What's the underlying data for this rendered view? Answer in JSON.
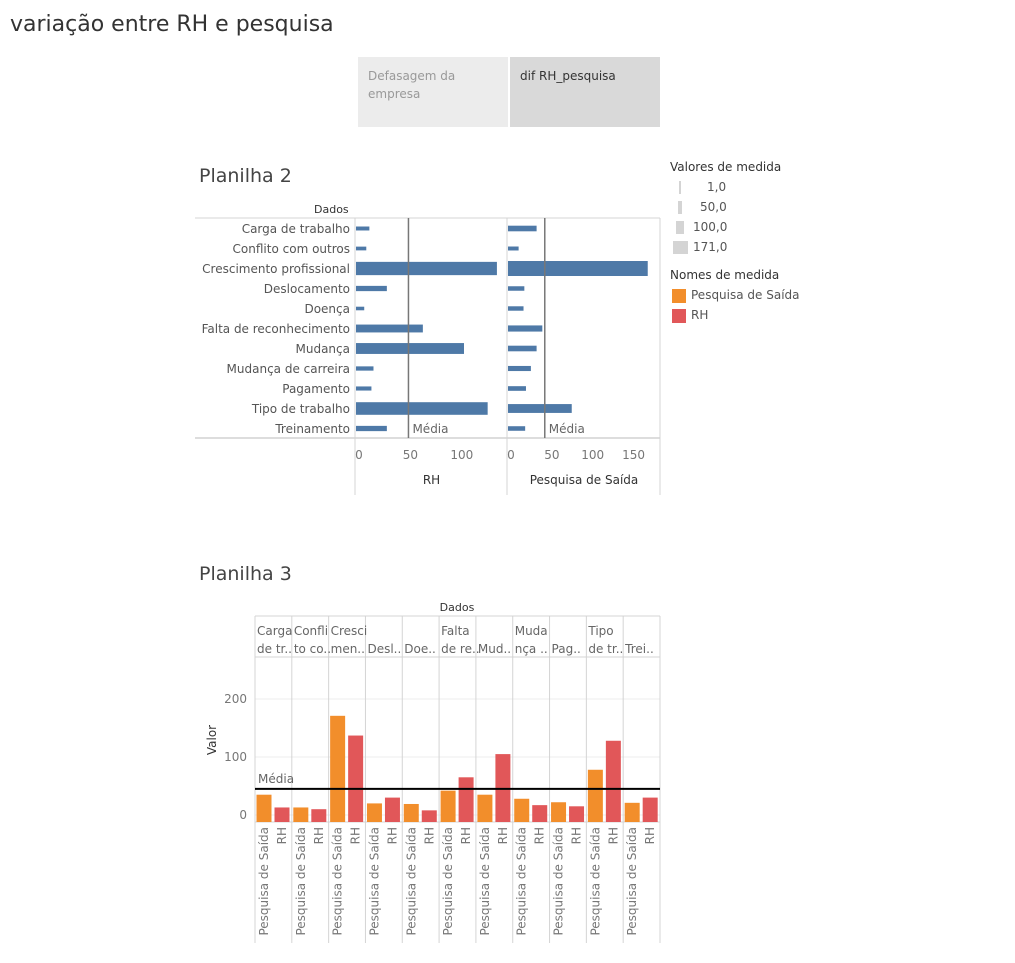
{
  "dashboard": {
    "title": "variação entre RH e pesquisa"
  },
  "tabs": [
    {
      "label_l1": "Defasagem da",
      "label_l2": "empresa"
    },
    {
      "label_l1": "dif RH_pesquisa",
      "label_l2": ""
    }
  ],
  "legend": {
    "size_title": "Valores de medida",
    "size_items": [
      "1,0",
      "50,0",
      "100,0",
      "171,0"
    ],
    "color_title": "Nomes de medida",
    "color_items": [
      {
        "label": "Pesquisa de Saída",
        "color": "#f28e2b"
      },
      {
        "label": "RH",
        "color": "#e15759"
      }
    ]
  },
  "chart_data": [
    {
      "type": "bar",
      "orientation": "horizontal",
      "title": "Planilha 2",
      "header": "Dados",
      "categories": [
        "Carga de trabalho",
        "Conflito com outros",
        "Crescimento profissional",
        "Deslocamento",
        "Doença",
        "Falta de reconhecimento",
        "Mudança",
        "Mudança de carreira",
        "Pagamento",
        "Tipo de trabalho",
        "Treinamento"
      ],
      "series": [
        {
          "name": "RH",
          "values": [
            13,
            10,
            137,
            30,
            8,
            65,
            105,
            17,
            15,
            128,
            30
          ],
          "xlim": [
            0,
            140
          ],
          "ticks": [
            0,
            50,
            100
          ],
          "mean": 51
        },
        {
          "name": "Pesquisa de Saída",
          "values": [
            35,
            13,
            171,
            20,
            19,
            42,
            35,
            28,
            22,
            78,
            21
          ],
          "xlim": [
            0,
            175
          ],
          "ticks": [
            0,
            50,
            100,
            150
          ],
          "mean": 45
        }
      ],
      "reference_label": "Média",
      "color": "#4e79a7"
    },
    {
      "type": "bar",
      "orientation": "vertical",
      "title": "Planilha 3",
      "header": "Dados",
      "ylabel": "Valor",
      "ylim": [
        -10,
        260
      ],
      "yticks": [
        0,
        100,
        200
      ],
      "groups_l1": [
        "Carga",
        "Confli",
        "Cresci",
        "",
        "",
        "Falta",
        "",
        "Muda",
        "",
        "Tipo",
        ""
      ],
      "groups_l2": [
        "de tr..",
        "to co..",
        "men..",
        "Desl..",
        "Doe..",
        "de re..",
        "Mud..",
        "nça ..",
        "Pag..",
        "de tr..",
        "Trei.."
      ],
      "series": [
        {
          "name": "Pesquisa de Saída",
          "values": [
            35,
            13,
            171,
            20,
            19,
            42,
            35,
            28,
            22,
            78,
            21
          ],
          "color": "#f28e2b"
        },
        {
          "name": "RH",
          "values": [
            13,
            10,
            137,
            30,
            8,
            65,
            105,
            17,
            15,
            128,
            30
          ],
          "color": "#e15759"
        }
      ],
      "mean": 45,
      "reference_label": "Média"
    }
  ]
}
